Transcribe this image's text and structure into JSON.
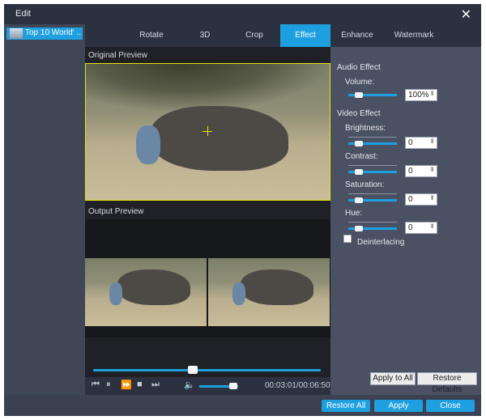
{
  "window": {
    "title": "Edit",
    "close_icon": "close-icon"
  },
  "file_list": {
    "items": [
      {
        "label": "Top 10 World' ..."
      }
    ]
  },
  "tabs": [
    {
      "label": "Rotate"
    },
    {
      "label": "3D"
    },
    {
      "label": "Crop"
    },
    {
      "label": "Effect",
      "active": true
    },
    {
      "label": "Enhance"
    },
    {
      "label": "Watermark"
    }
  ],
  "preview": {
    "original_label": "Original Preview",
    "output_label": "Output Preview"
  },
  "playback": {
    "time": "00:03:01/00:06:50",
    "progress": 0.44,
    "volume": 0.8
  },
  "audio_effect": {
    "header": "Audio Effect",
    "volume_label": "Volume:",
    "volume_value": "100%"
  },
  "video_effect": {
    "header": "Video Effect",
    "brightness_label": "Brightness:",
    "brightness_value": "0",
    "contrast_label": "Contrast:",
    "contrast_value": "0",
    "saturation_label": "Saturation:",
    "saturation_value": "0",
    "hue_label": "Hue:",
    "hue_value": "0",
    "deinterlacing_label": "Deinterlacing"
  },
  "actions": {
    "apply_to_all": "Apply to All",
    "restore_defaults": "Restore Defaults",
    "restore_all": "Restore All",
    "apply": "Apply",
    "close": "Close"
  },
  "colors": {
    "accent": "#1ea0e0",
    "panel": "#3b4151",
    "dark": "#2c3140",
    "highlight": "#e8e600"
  }
}
